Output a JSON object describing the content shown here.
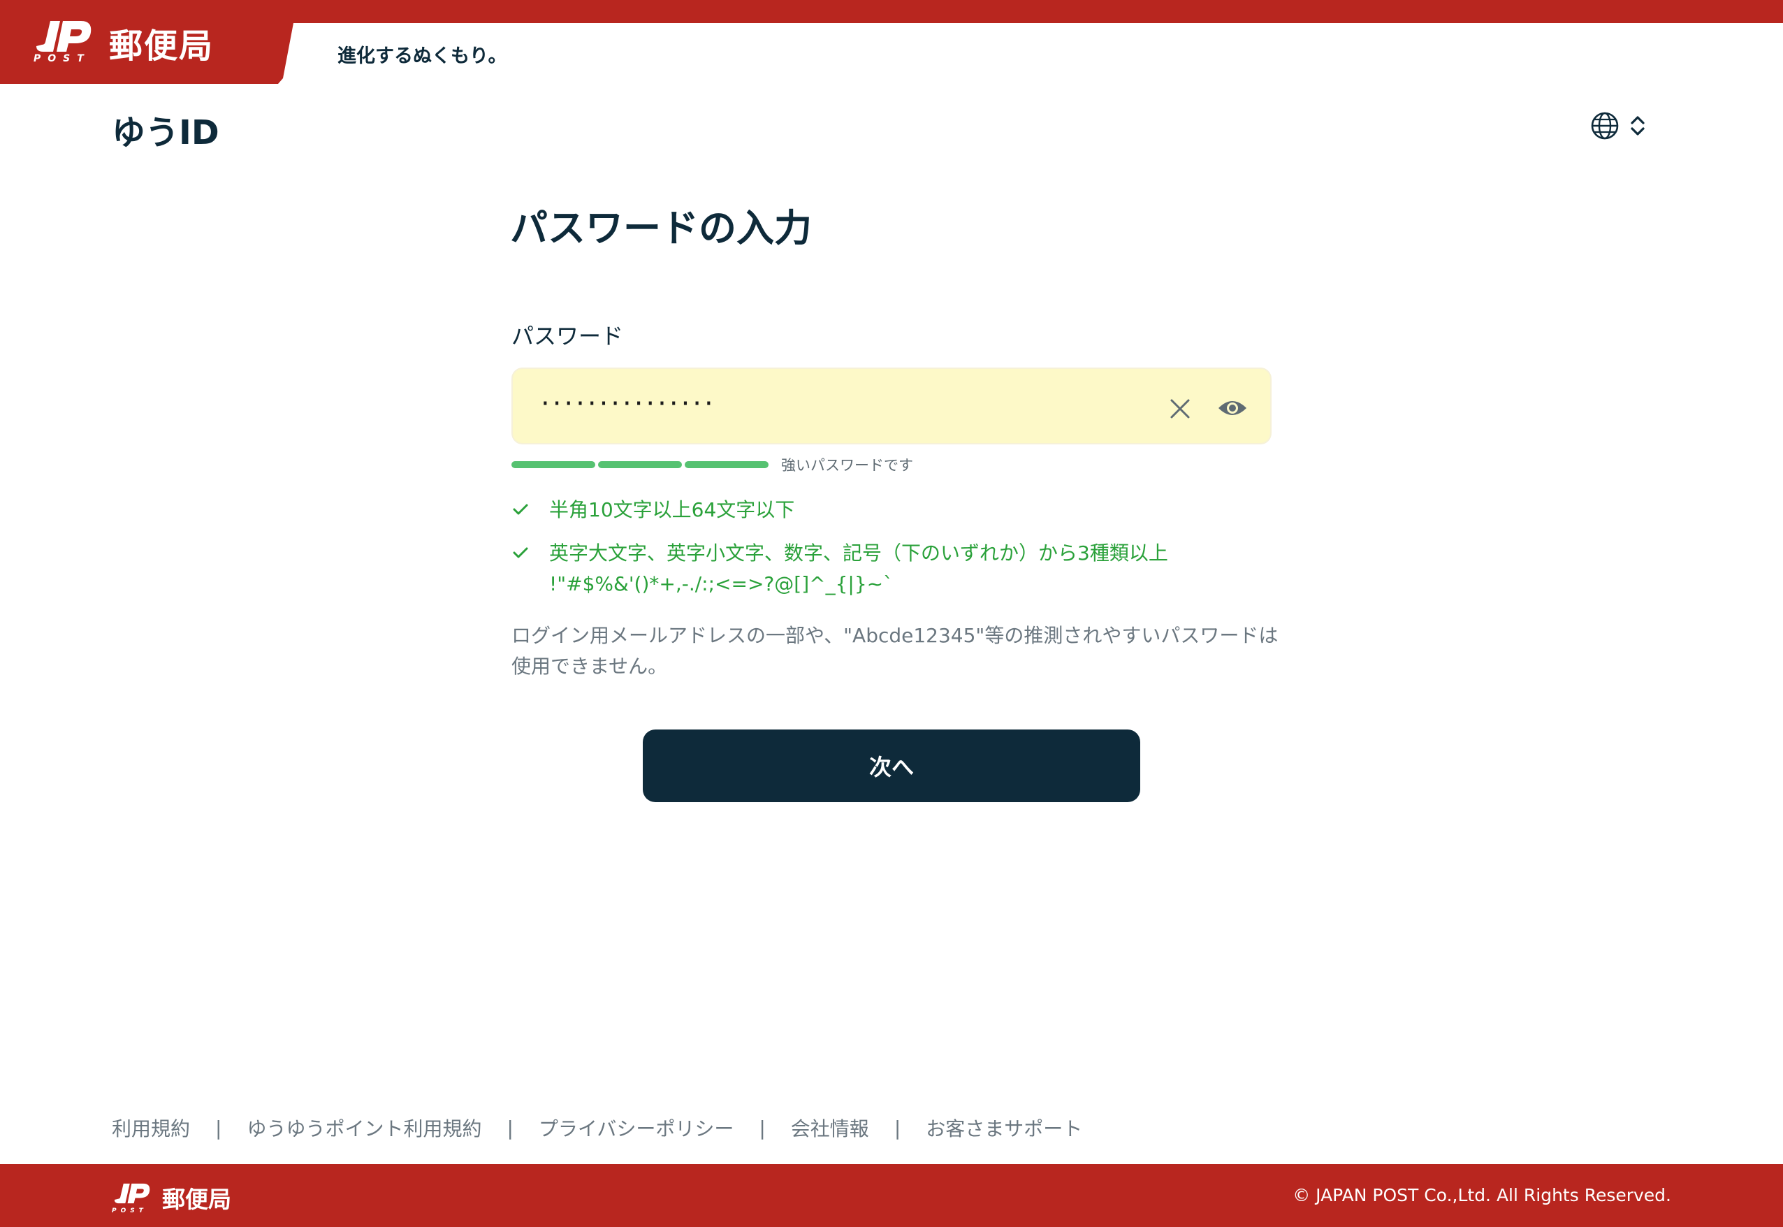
{
  "colors": {
    "brand_red": "#b8261f",
    "navy": "#0e2a3a",
    "field_bg": "#fdf9c8",
    "success_green": "#2aa13a",
    "strength_green": "#56c271",
    "muted_gray": "#6b7780"
  },
  "header": {
    "logo_mark": "JP",
    "logo_post": "POST",
    "logo_name": "郵便局",
    "tagline": "進化するぬくもり。",
    "service_title": "ゆうID",
    "lang_icon": "globe-icon",
    "lang_toggle_icon": "chevron-up-down-icon"
  },
  "form": {
    "title": "パスワードの入力",
    "field_label": "パスワード",
    "password_masked": "···············",
    "clear_icon": "close-icon",
    "reveal_icon": "eye-icon",
    "strength": {
      "level": 3,
      "max": 3,
      "label": "強いパスワードです"
    },
    "rules": [
      {
        "text": "半角10文字以上64文字以下",
        "satisfied": true
      },
      {
        "text": "英字大文字、英字小文字、数字、記号（下のいずれか）から3種類以上",
        "detail": "!\"#$%&'()*+,-./:;<=>?@[]^_{|}~`",
        "satisfied": true
      }
    ],
    "note": "ログイン用メールアドレスの一部や、\"Abcde12345\"等の推測されやすいパスワードは使用できません。",
    "next_label": "次へ"
  },
  "footer": {
    "links": [
      "利用規約",
      "ゆうゆうポイント利用規約",
      "プライバシーポリシー",
      "会社情報",
      "お客さまサポート"
    ],
    "separator": "|",
    "logo_mark": "JP",
    "logo_post": "POST",
    "logo_name": "郵便局",
    "copyright": "© JAPAN POST Co.,Ltd. All Rights Reserved."
  }
}
